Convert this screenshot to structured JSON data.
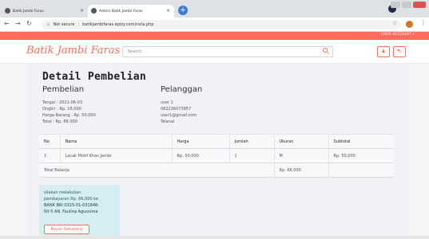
{
  "browser": {
    "tabs": [
      {
        "label": "Batik Jambi Faras",
        "active": false
      },
      {
        "label": "Admin Batik Jambi Faras",
        "active": true
      }
    ],
    "security_label": "Not secure",
    "url": "batikjambifaras.epizy.com/nota.php"
  },
  "site": {
    "user_account": "USER ACCOUNT ▾",
    "logo": "Batik Jambi Faras",
    "search_placeholder": "Search",
    "accent": "#ff6b5e"
  },
  "page": {
    "title": "Detail Pembelian",
    "pembelian": {
      "heading": "Pembelian",
      "tanggal": "Tangal : 2021-06-03",
      "ongkir": "Ongkir : Rp. 16,000",
      "harga_barang": "Harga Barang : Rp. 50,000",
      "total": "Total : Rp. 66,000"
    },
    "pelanggan": {
      "heading": "Pelanggan",
      "name": "user 1",
      "phone": "082236073957",
      "email": "user1@gmail.com",
      "city": "Telanai"
    },
    "table": {
      "headers": [
        "No",
        "Nama",
        "Harga",
        "Jumlah",
        "Ukuran",
        "Subtotal"
      ],
      "rows": [
        [
          "1",
          "Lacak Motif Khas Jambi",
          "Rp. 50,000",
          "1",
          "M",
          "Rp. 50,000"
        ]
      ],
      "total_label": "Total Belanja",
      "total_value": "Rp. 66,000"
    },
    "payment": {
      "line1": "silakan melakukan",
      "line2": "pembayaran Rp. 66,000 ke",
      "line3": "BANK BRI 0315-01-031848-",
      "line4": "50-5 AN. Faulina Agusnima",
      "button": "Bayar Sekarang"
    }
  }
}
